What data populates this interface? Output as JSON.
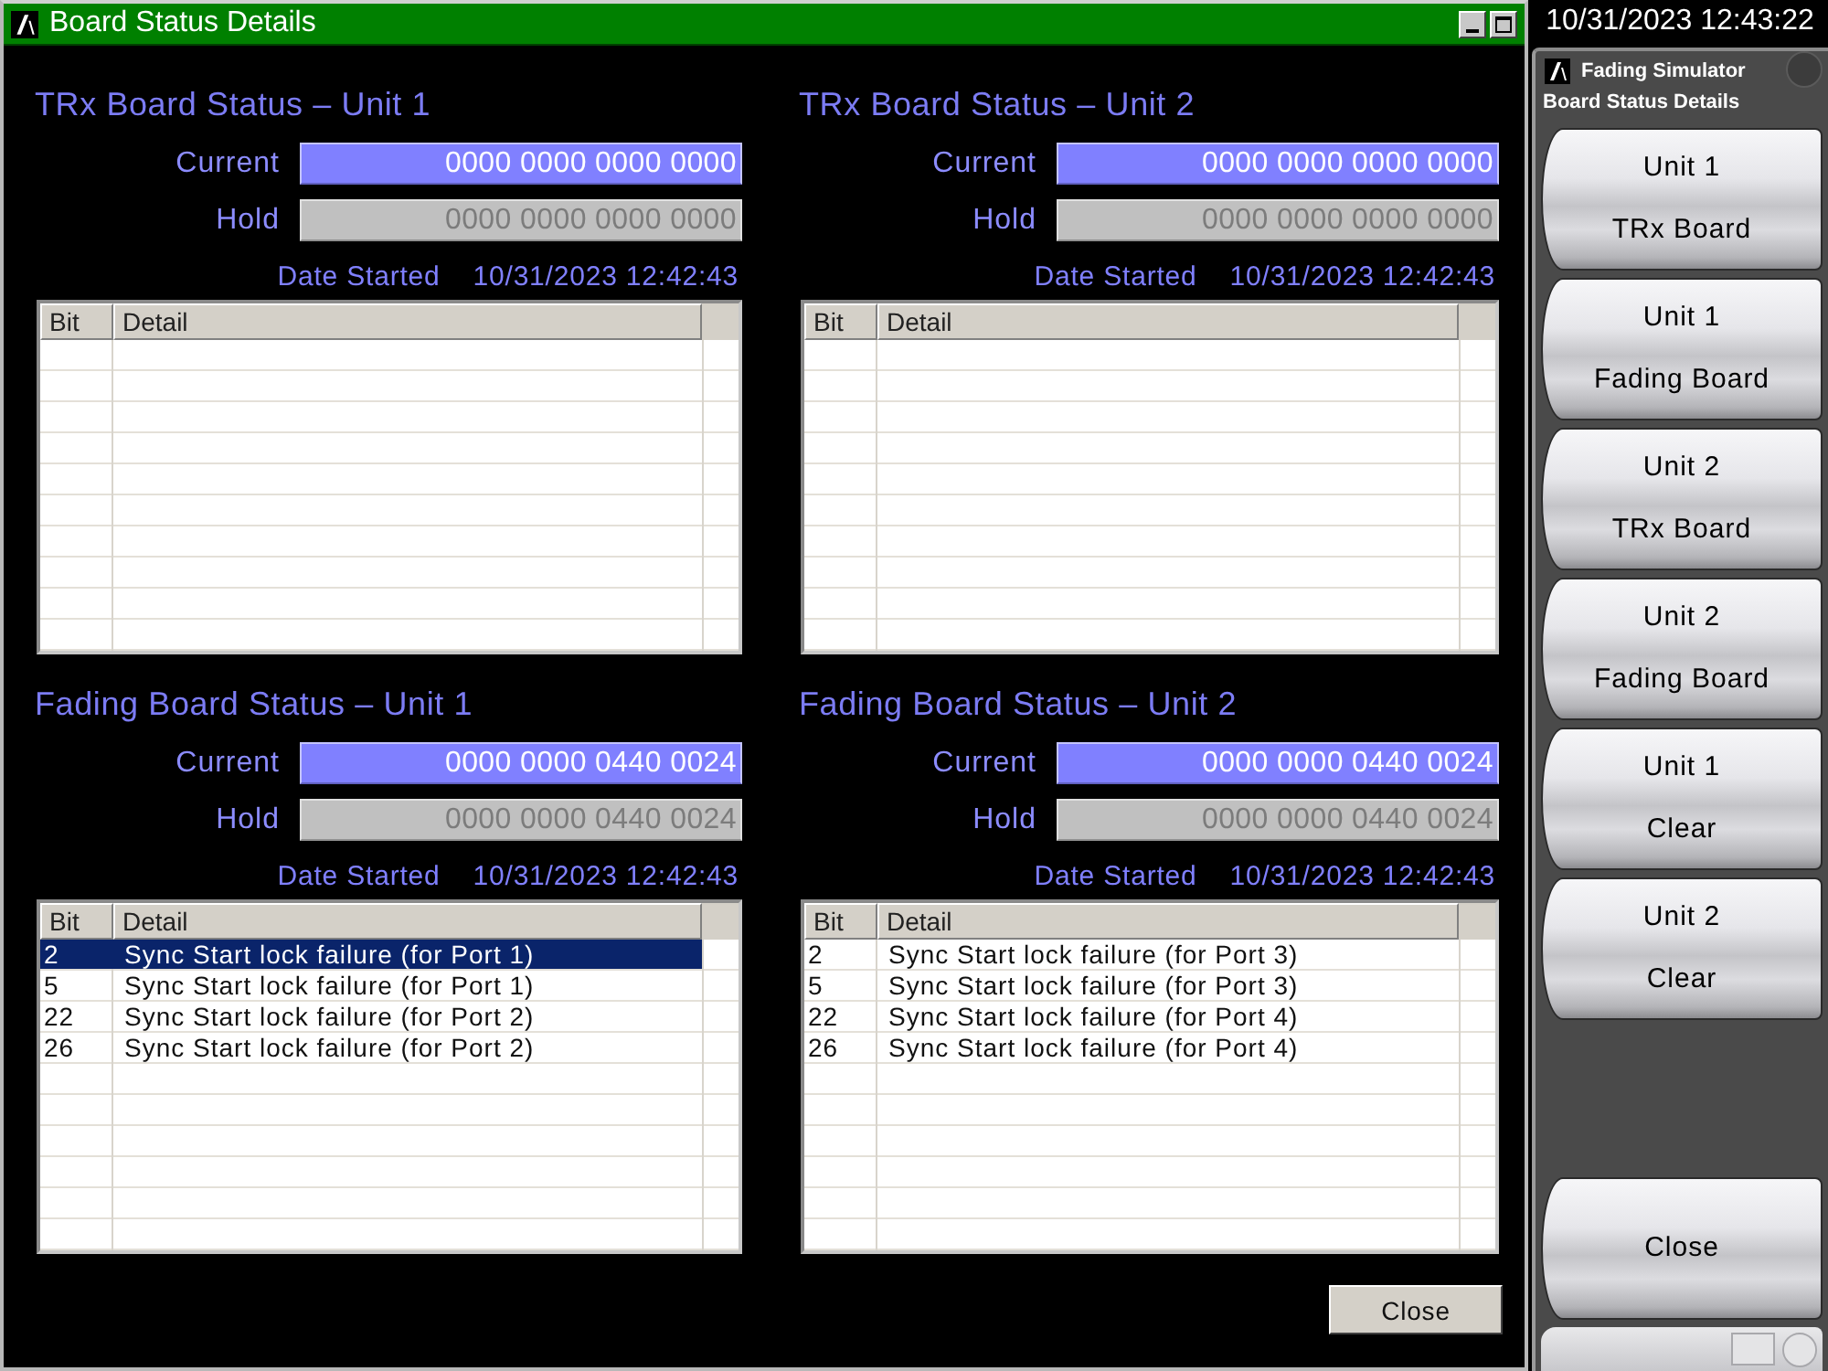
{
  "window": {
    "title": "Board Status Details"
  },
  "sections": [
    {
      "title": "TRx Board Status – Unit 1",
      "current_label": "Current",
      "current_value": "0000 0000 0000 0000",
      "hold_label": "Hold",
      "hold_value": "0000 0000 0000 0000",
      "date_label": "Date Started",
      "date_value": "10/31/2023 12:42:43",
      "table": {
        "columns": [
          "Bit",
          "Detail"
        ]
      }
    },
    {
      "title": "TRx Board Status – Unit 2",
      "current_label": "Current",
      "current_value": "0000 0000 0000 0000",
      "hold_label": "Hold",
      "hold_value": "0000 0000 0000 0000",
      "date_label": "Date Started",
      "date_value": "10/31/2023 12:42:43",
      "table": {
        "columns": [
          "Bit",
          "Detail"
        ]
      }
    },
    {
      "title": "Fading Board Status – Unit 1",
      "current_label": "Current",
      "current_value": "0000 0000 0440 0024",
      "hold_label": "Hold",
      "hold_value": "0000 0000 0440 0024",
      "date_label": "Date Started",
      "date_value": "10/31/2023 12:42:43",
      "table": {
        "columns": [
          "Bit",
          "Detail"
        ],
        "rows": [
          {
            "bit": "2",
            "detail": "Sync Start lock failure (for Port 1)",
            "selected": true
          },
          {
            "bit": "5",
            "detail": "Sync Start lock failure (for Port 1)",
            "selected": false
          },
          {
            "bit": "22",
            "detail": "Sync Start lock failure (for Port 2)",
            "selected": false
          },
          {
            "bit": "26",
            "detail": "Sync Start lock failure (for Port 2)",
            "selected": false
          }
        ]
      }
    },
    {
      "title": "Fading Board Status – Unit 2",
      "current_label": "Current",
      "current_value": "0000 0000 0440 0024",
      "hold_label": "Hold",
      "hold_value": "0000 0000 0440 0024",
      "date_label": "Date Started",
      "date_value": "10/31/2023 12:42:43",
      "table": {
        "columns": [
          "Bit",
          "Detail"
        ],
        "rows": [
          {
            "bit": "2",
            "detail": "Sync Start lock failure (for Port 3)",
            "selected": false
          },
          {
            "bit": "5",
            "detail": "Sync Start lock failure (for Port 3)",
            "selected": false
          },
          {
            "bit": "22",
            "detail": "Sync Start lock failure (for Port 4)",
            "selected": false
          },
          {
            "bit": "26",
            "detail": "Sync Start lock failure (for Port 4)",
            "selected": false
          }
        ]
      }
    }
  ],
  "close_button": "Close",
  "side_panel": {
    "clock": "10/31/2023 12:43:22",
    "app_name": "Fading Simulator",
    "screen_name": "Board Status Details",
    "buttons": [
      {
        "line_1": "Unit 1",
        "line_2": "TRx Board"
      },
      {
        "line_1": "Unit 1",
        "line_2": "Fading Board"
      },
      {
        "line_1": "Unit 2",
        "line_2": "TRx Board"
      },
      {
        "line_1": "Unit 2",
        "line_2": "Fading Board"
      },
      {
        "line_1": "Unit 1",
        "line_2": "Clear"
      },
      {
        "line_1": "Unit 2",
        "line_2": "Clear"
      }
    ],
    "close_button": "Close"
  }
}
